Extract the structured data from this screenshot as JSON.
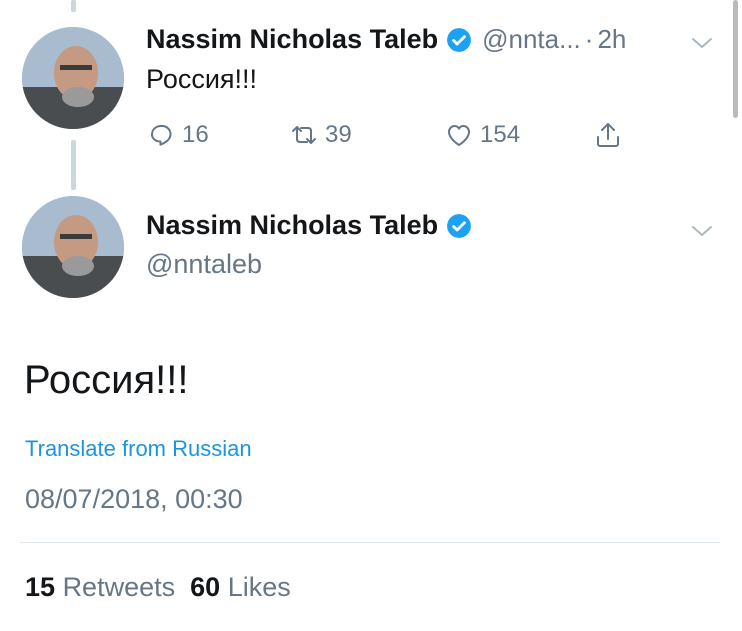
{
  "thread_tweet": {
    "name": "Nassim Nicholas Taleb",
    "handle": "@nnta...",
    "separator": "·",
    "time": "2h",
    "text": "Россия!!!",
    "replies": "16",
    "retweets": "39",
    "likes": "154"
  },
  "main_tweet": {
    "name": "Nassim Nicholas Taleb",
    "handle": "@nntaleb",
    "text": "Россия!!!",
    "translate_label": "Translate from Russian",
    "timestamp": "08/07/2018, 00:30",
    "retweet_count": "15",
    "retweet_label": "Retweets",
    "like_count": "60",
    "like_label": "Likes"
  },
  "icons": [
    "verified-badge-icon",
    "chevron-down-icon",
    "reply-icon",
    "retweet-icon",
    "like-icon",
    "share-icon"
  ],
  "colors": {
    "verified": "#1da1f2",
    "link": "#1b95e0",
    "secondary_text": "#657786",
    "primary_text": "#14171a"
  }
}
